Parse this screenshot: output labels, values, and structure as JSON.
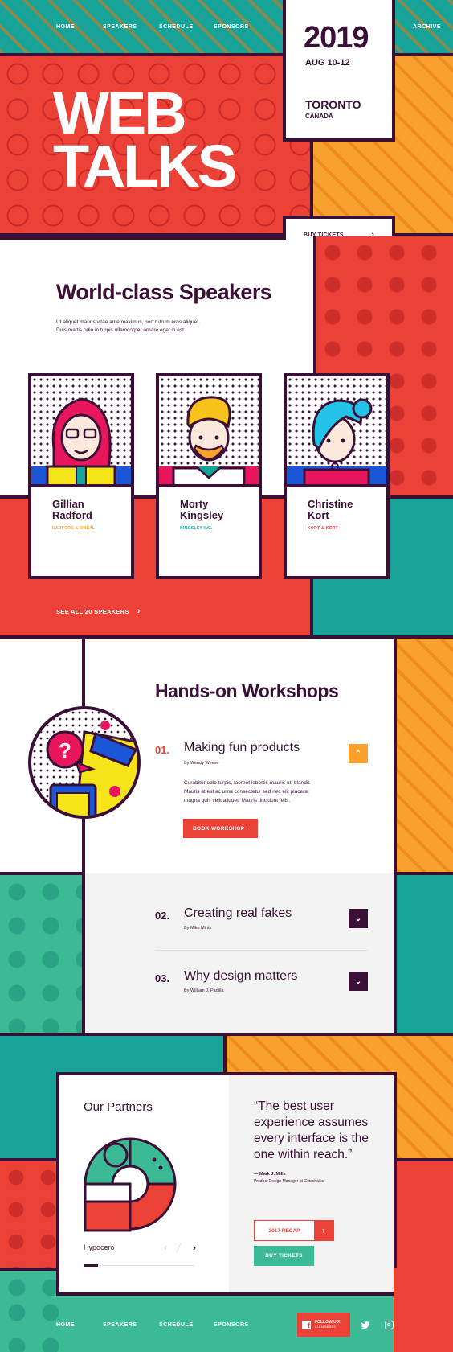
{
  "nav": {
    "items": [
      "HOME",
      "SPEAKERS",
      "SCHEDULE",
      "SPONSORS"
    ],
    "archive": "ARCHIVE"
  },
  "event": {
    "year": "2019",
    "dates": "AUG 10-12",
    "city": "TORONTO",
    "country": "CANADA",
    "title_line1": "WEB",
    "title_line2": "TALKS",
    "buy_tickets": "BUY TICKETS"
  },
  "speakers_section": {
    "heading": "World-class Speakers",
    "intro_line1": "Ut aliquet mauris vitae ante maximus, non rutrum eros aliquet.",
    "intro_line2": "Duis mattis odio in turpis ullamcorper ornare eget in est.",
    "see_all": "SEE ALL 20 SPEAKERS",
    "speakers": [
      {
        "first": "Gillian",
        "last": "Radford",
        "company": "RADFORD & ONEAL",
        "company_color": "#f9a12e"
      },
      {
        "first": "Morty",
        "last": "Kingsley",
        "company": "KINGSLEY INC.",
        "company_color": "#17a398"
      },
      {
        "first": "Christine",
        "last": "Kort",
        "company": "KORT & KORT",
        "company_color": "#ec4137"
      }
    ]
  },
  "workshops": {
    "heading": "Hands-on Workshops",
    "items": [
      {
        "number": "01.",
        "title": "Making fun products",
        "by": "By Wendy Weese",
        "desc_line1": "Curabitur odio turpis, laoreet lobortis mauris ut, blandit.",
        "desc_line2": "Mauris at est ac urna consectetur sed nec elit placerat",
        "desc_line3": "magna quis velit aliquet. Mauris tincidunt felis.",
        "cta": "BOOK WORKSHOP ›",
        "expanded": true
      },
      {
        "number": "02.",
        "title": "Creating real fakes",
        "by": "By Mike Mints",
        "expanded": false
      },
      {
        "number": "03.",
        "title": "Why design matters",
        "by": "By William J. Padilla",
        "expanded": false
      }
    ]
  },
  "partners": {
    "heading": "Our Partners",
    "partner_name": "Hypocero",
    "quote": "“The best user experience assumes every interface is the one within reach.”",
    "quote_author": "— Mark J. Mills",
    "quote_role": "Product Design Manager at Gotschalks",
    "recap": "2017 RECAP",
    "buy_tickets": "BUY TICKETS"
  },
  "footer": {
    "items": [
      "HOME",
      "SPEAKERS",
      "SCHEDULE",
      "SPONSORS"
    ],
    "follow_line1": "FOLLOW US!",
    "follow_line2": "2.1K MEMBERS"
  },
  "colors": {
    "plum": "#3a1036",
    "red": "#ec4137",
    "teal": "#3cb995",
    "orange": "#f9a12e"
  }
}
